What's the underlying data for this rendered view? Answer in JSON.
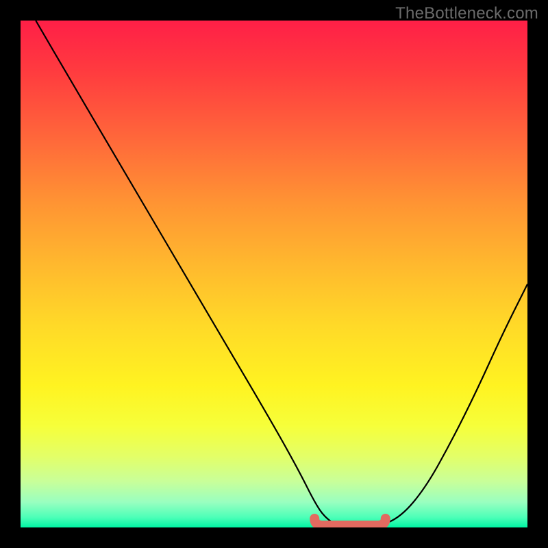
{
  "watermark": "TheBottleneck.com",
  "colors": {
    "background": "#000000",
    "gradient_top": "#ff1f47",
    "gradient_mid": "#ffd928",
    "gradient_bottom": "#00f5a3",
    "curve": "#000000",
    "valley_marker": "#e26a60"
  },
  "chart_data": {
    "type": "line",
    "title": "",
    "xlabel": "",
    "ylabel": "",
    "xlim": [
      0,
      100
    ],
    "ylim": [
      0,
      100
    ],
    "grid": false,
    "legend": false,
    "series": [
      {
        "name": "bottleneck-curve",
        "x": [
          3,
          10,
          20,
          30,
          40,
          50,
          55,
          58,
          60,
          63,
          66,
          70,
          75,
          80,
          85,
          90,
          95,
          100
        ],
        "y": [
          100,
          88,
          71,
          54,
          37,
          20,
          11,
          5,
          2,
          0,
          0,
          0,
          2,
          8,
          17,
          27,
          38,
          48
        ]
      }
    ],
    "annotations": [
      {
        "name": "valley-flat-marker",
        "x_start": 58,
        "x_end": 72,
        "y": 0
      }
    ]
  }
}
